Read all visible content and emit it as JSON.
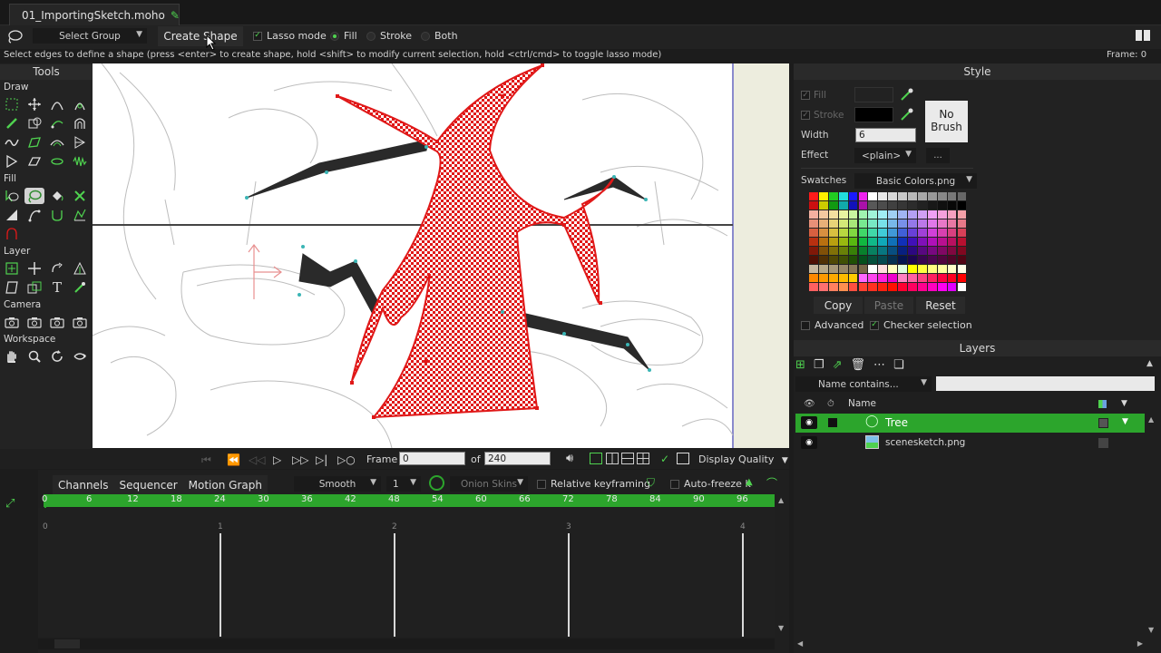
{
  "document": {
    "tab_title": "01_ImportingSketch.moho"
  },
  "toolbar": {
    "group_select": "Select Group",
    "create_shape": "Create Shape",
    "lasso_label": "Lasso mode",
    "fill_label": "Fill",
    "stroke_label": "Stroke",
    "both_label": "Both",
    "selected_mode": "Fill",
    "lasso_checked": true
  },
  "status": {
    "message": "Select edges to define a shape (press <enter> to create shape, hold <shift> to modify current selection, hold <ctrl/cmd> to toggle lasso mode)",
    "frame": "Frame: 0"
  },
  "tools": {
    "title": "Tools",
    "sections": [
      "Draw",
      "Fill",
      "Layer",
      "Camera",
      "Workspace"
    ]
  },
  "timeline": {
    "frame_label": "Frame",
    "frame_value": "0",
    "of_label": "of",
    "total_frames": "240",
    "display_quality": "Display Quality",
    "tabs": [
      "Channels",
      "Sequencer",
      "Motion Graph"
    ],
    "interpolation": "Smooth",
    "interp_value": "1",
    "onion_skins": "Onion Skins",
    "relative_keyframing": "Relative keyframing",
    "auto_freeze": "Auto-freeze k",
    "ruler_ticks": [
      "0",
      "6",
      "12",
      "18",
      "24",
      "30",
      "36",
      "42",
      "48",
      "54",
      "60",
      "66",
      "72",
      "78",
      "84",
      "90",
      "96"
    ],
    "second_marks": [
      "0",
      "1",
      "2",
      "3",
      "4"
    ]
  },
  "style": {
    "title": "Style",
    "fill_label": "Fill",
    "stroke_label": "Stroke",
    "width_label": "Width",
    "width_value": "6",
    "effect_label": "Effect",
    "effect_value": "<plain>",
    "effect_more": "...",
    "no_brush": [
      "No",
      "Brush"
    ],
    "swatches_label": "Swatches",
    "swatches_value": "Basic Colors.png",
    "copy": "Copy",
    "paste": "Paste",
    "reset": "Reset",
    "advanced": "Advanced",
    "checker_selection": "Checker selection",
    "stroke_color": "#000000",
    "fill_color": "#222222"
  },
  "layers": {
    "title": "Layers",
    "filter_placeholder": "Name contains...",
    "name_header": "Name",
    "rows": [
      {
        "name": "Tree",
        "selected": true
      },
      {
        "name": "scenesketch.png",
        "selected": false
      }
    ]
  },
  "colors": {
    "accent_green": "#2ca52c",
    "selection_red": "#e01818"
  }
}
